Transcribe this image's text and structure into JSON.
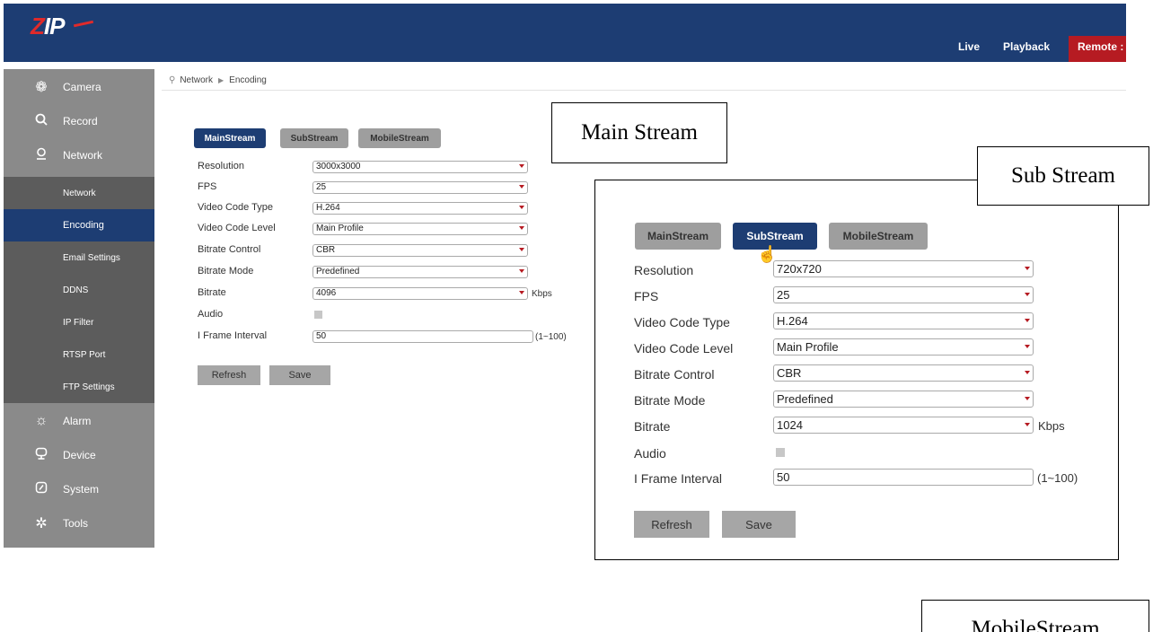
{
  "header": {
    "logo_z": "Z",
    "logo_ip": "IP",
    "nav": {
      "live": "Live",
      "playback": "Playback",
      "remote": "Remote :"
    }
  },
  "sidebar": {
    "camera": "Camera",
    "record": "Record",
    "network": "Network",
    "sub": {
      "network": "Network",
      "encoding": "Encoding",
      "email": "Email Settings",
      "ddns": "DDNS",
      "ipfilter": "IP Filter",
      "rtsp": "RTSP Port",
      "ftp": "FTP Settings"
    },
    "alarm": "Alarm",
    "device": "Device",
    "system": "System",
    "tools": "Tools"
  },
  "breadcrumb": {
    "first": "Network",
    "second": "Encoding"
  },
  "tabs": {
    "main": "MainStream",
    "sub": "SubStream",
    "mobile": "MobileStream"
  },
  "labels": {
    "resolution": "Resolution",
    "fps": "FPS",
    "video_code_type": "Video Code Type",
    "video_code_level": "Video Code Level",
    "bitrate_control": "Bitrate Control",
    "bitrate_mode": "Bitrate Mode",
    "bitrate": "Bitrate",
    "audio": "Audio",
    "iframe_interval": "I Frame Interval"
  },
  "main_form": {
    "resolution": "3000x3000",
    "fps": "25",
    "video_code_type": "H.264",
    "video_code_level": "Main Profile",
    "bitrate_control": "CBR",
    "bitrate_mode": "Predefined",
    "bitrate": "4096",
    "iframe_interval": "50"
  },
  "sub_form": {
    "resolution": "720x720",
    "fps": "25",
    "video_code_type": "H.264",
    "video_code_level": "Main Profile",
    "bitrate_control": "CBR",
    "bitrate_mode": "Predefined",
    "bitrate": "1024",
    "iframe_interval": "50"
  },
  "units": {
    "kbps": "Kbps",
    "range": "(1~100)"
  },
  "buttons": {
    "refresh": "Refresh",
    "save": "Save"
  },
  "callouts": {
    "main": "Main Stream",
    "sub": "Sub Stream",
    "mobile": "MobileStream"
  },
  "icons": {
    "camera": "camera-icon",
    "record": "search-icon",
    "network": "network-icon",
    "alarm": "alarm-icon",
    "device": "monitor-icon",
    "system": "system-icon",
    "tools": "gear-icon",
    "breadcrumb": "location-pin-icon",
    "cursor": "hand-pointer-icon"
  },
  "colors": {
    "navy": "#1d3d73",
    "red": "#b61b22",
    "sidebar": "#8a8a8a",
    "sub_sidebar": "#5c5c5c"
  }
}
